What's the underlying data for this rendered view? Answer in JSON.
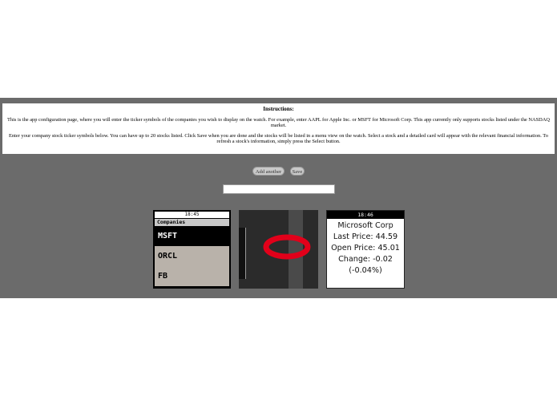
{
  "instructions": {
    "title": "Instructions:",
    "paragraph1": "This is the app configuration page, where you will enter the ticker symbols of the companies you wish to display on the watch. For example, enter AAPL for Apple Inc. or MSFT for Microsoft Corp. This app currently only supports stocks listed under the NASDAQ market.",
    "paragraph2": "Enter your company stock ticker symbols below. You can have up to 20 stocks listed. Click Save when you are done and the stocks will be listed in a menu view on the watch. Select a stock and a detailed card will appear with the relevant financial information. To refresh a stock's information, simply press the Select button."
  },
  "buttons": {
    "add_another": "Add another",
    "save": "Save"
  },
  "ticker_input": {
    "value": "",
    "placeholder": ""
  },
  "watch_menu": {
    "time": "18:45",
    "header": "Companies",
    "items": [
      "MSFT",
      "ORCL",
      "FB"
    ],
    "selected_index": 0
  },
  "watch_logo": {
    "icon": "oracle-logo-icon",
    "accent": "#e2001a"
  },
  "watch_detail": {
    "time": "18:46",
    "company": "Microsoft Corp",
    "last_price": "Last Price: 44.59",
    "open_price": "Open Price: 45.01",
    "change": "Change: -0.02",
    "change_pct": "(-0.04%)"
  },
  "colors": {
    "background": "#6b6b6b",
    "panel": "#ffffff",
    "menu_selected": "#000000",
    "menu_item": "#b9b2aa"
  }
}
